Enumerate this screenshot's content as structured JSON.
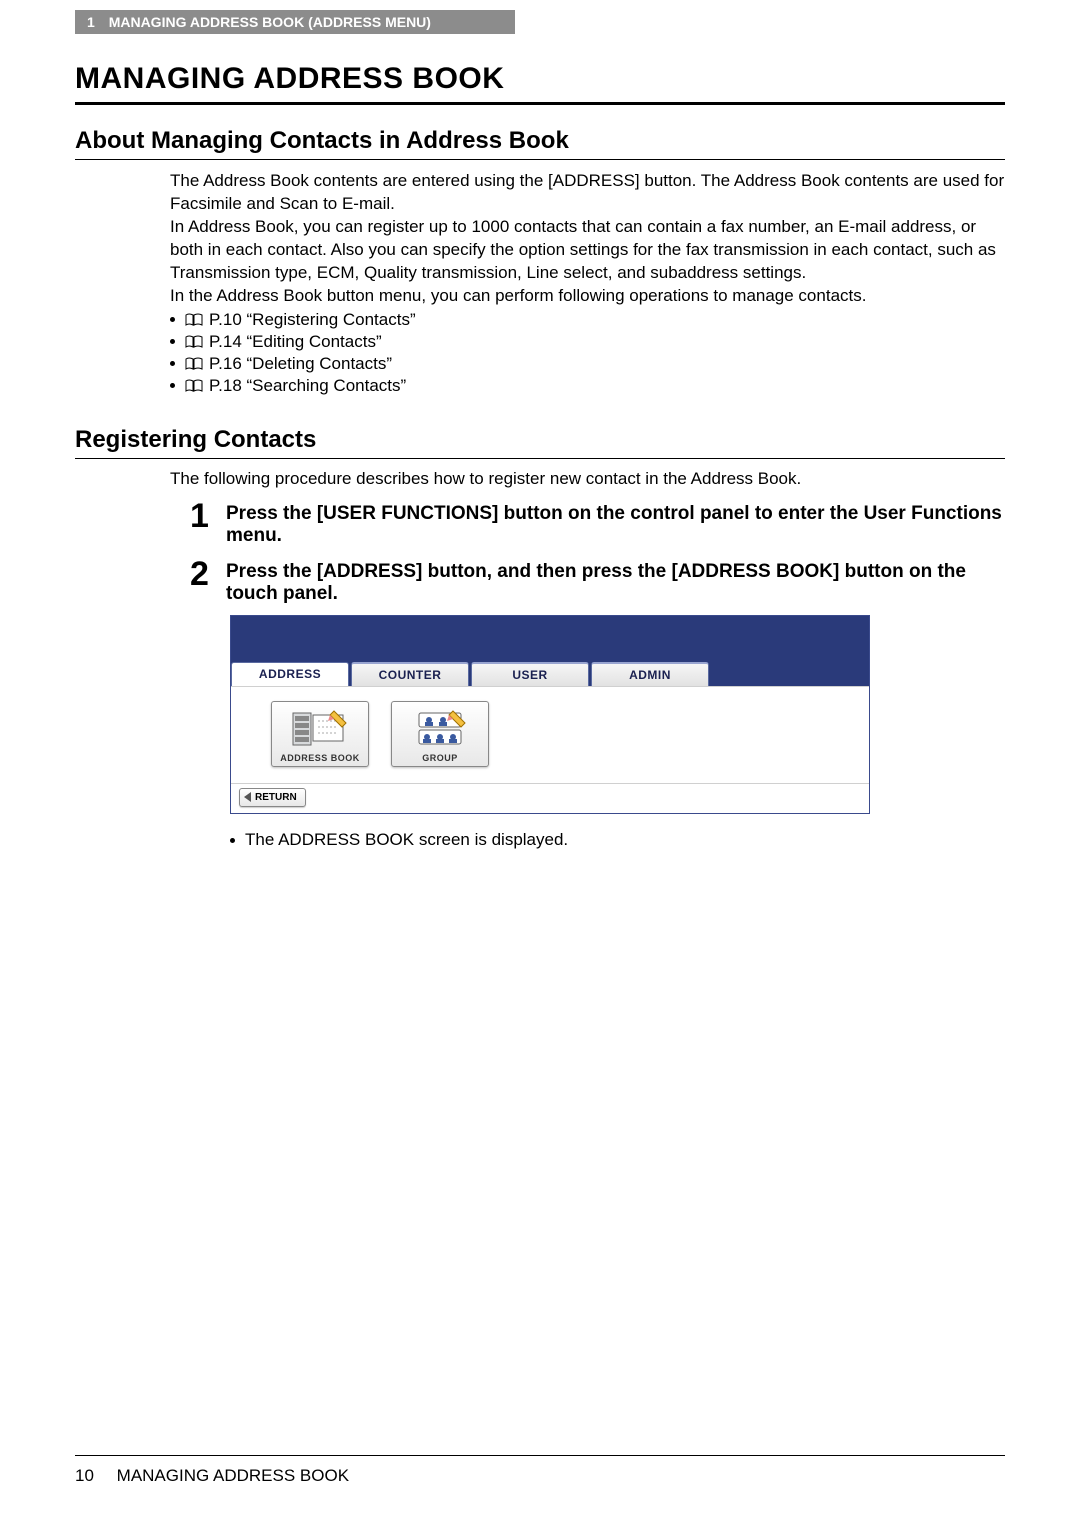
{
  "header": {
    "chapter_num": "1",
    "chapter_title": "MANAGING ADDRESS BOOK (ADDRESS MENU)"
  },
  "title": "MANAGING ADDRESS BOOK",
  "section1": {
    "heading": "About Managing Contacts in Address Book",
    "para1": "The Address Book contents are entered using the [ADDRESS] button.  The Address Book contents are used for Facsimile and Scan to E-mail.",
    "para2": "In Address Book, you can register up to 1000 contacts that can contain a fax number, an E-mail address, or both in each contact.  Also you can specify the option settings for the fax transmission in each contact, such as Transmission type, ECM, Quality transmission, Line select, and subaddress settings.",
    "para3": "In the Address Book button menu, you can perform following operations to manage contacts.",
    "links": [
      "P.10 “Registering Contacts”",
      "P.14 “Editing Contacts”",
      "P.16 “Deleting Contacts”",
      "P.18 “Searching Contacts”"
    ]
  },
  "section2": {
    "heading": "Registering Contacts",
    "intro": "The following procedure describes how to register new contact in the Address Book.",
    "steps": [
      {
        "num": "1",
        "text": "Press the [USER FUNCTIONS] button on the control panel to enter the User Functions menu."
      },
      {
        "num": "2",
        "text": "Press the [ADDRESS] button, and then press the [ADDRESS BOOK] button on the touch panel."
      }
    ],
    "after_note": "The ADDRESS BOOK screen is displayed."
  },
  "touchpanel": {
    "tabs": [
      "ADDRESS",
      "COUNTER",
      "USER",
      "ADMIN"
    ],
    "buttons": [
      {
        "label": "ADDRESS BOOK"
      },
      {
        "label": "GROUP"
      }
    ],
    "return": "RETURN"
  },
  "footer": {
    "page": "10",
    "title": "MANAGING ADDRESS BOOK"
  }
}
